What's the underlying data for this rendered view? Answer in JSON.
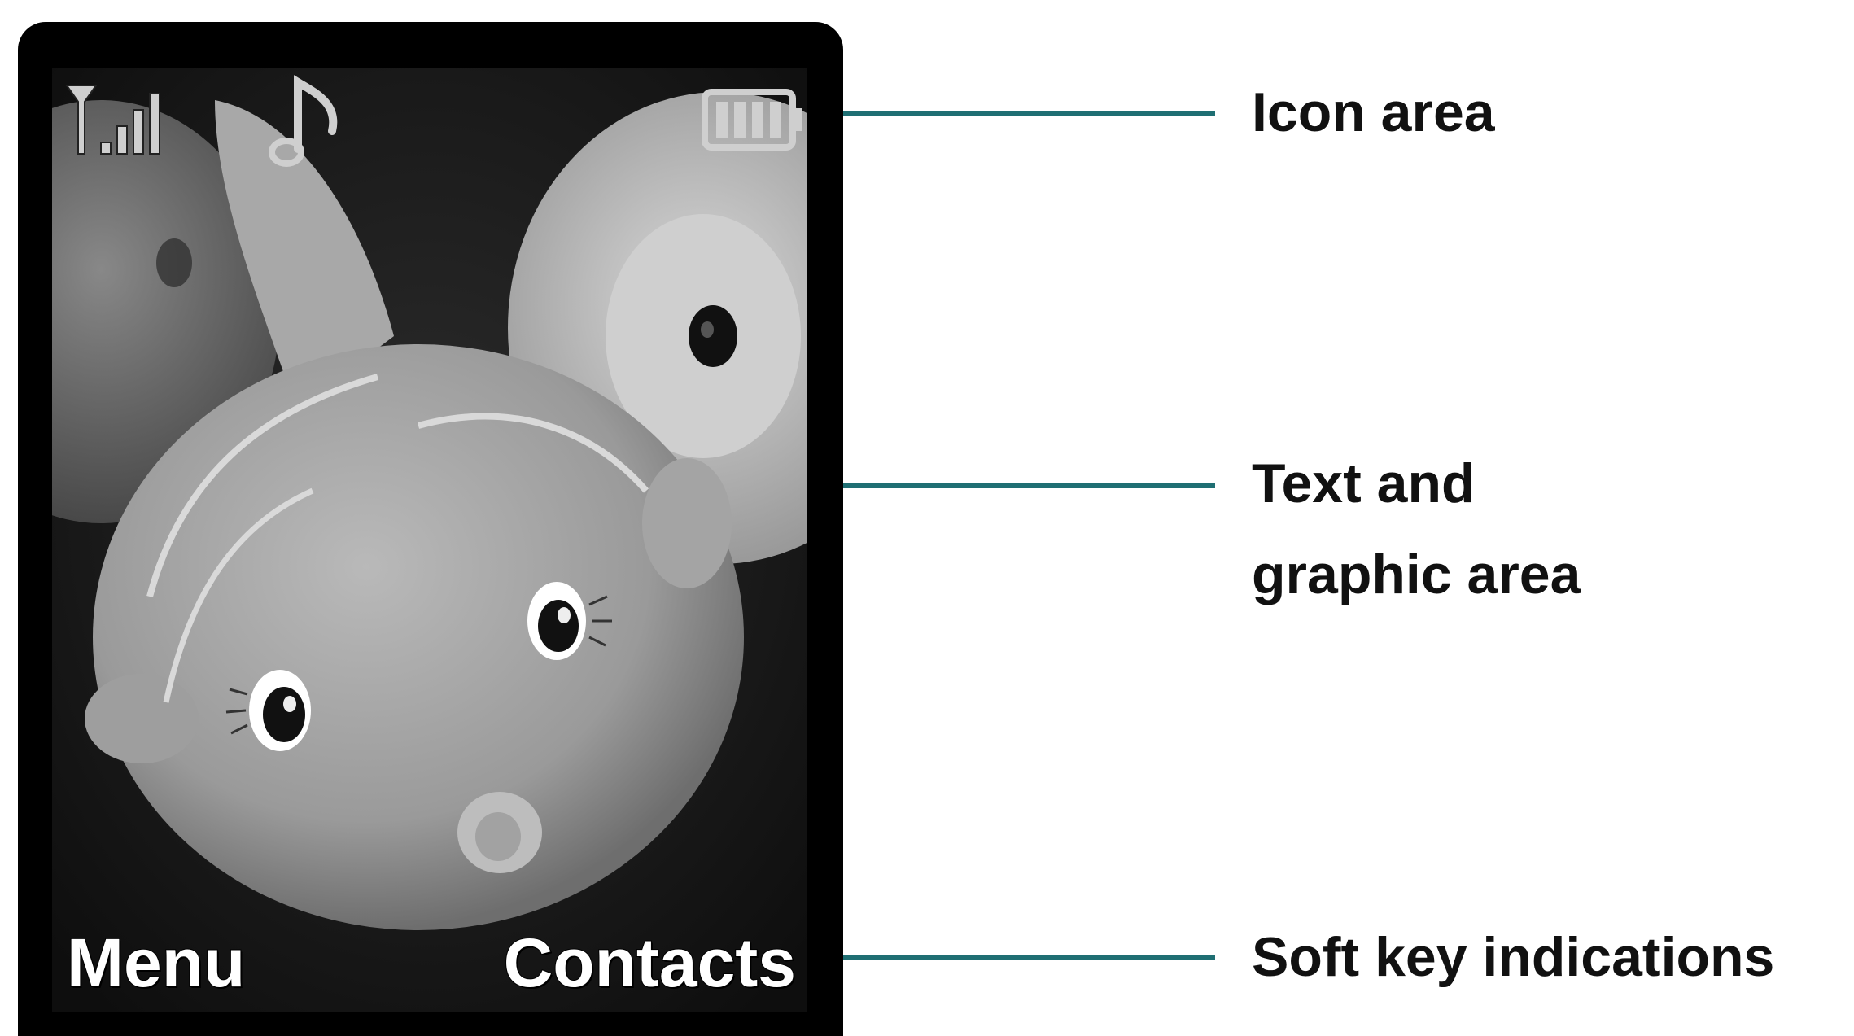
{
  "phone": {
    "soft_keys": {
      "left": "Menu",
      "right": "Contacts"
    },
    "status_icons": [
      "signal-strength-icon",
      "music-note-icon",
      "battery-icon"
    ],
    "wallpaper": "grayscale plush fish toys"
  },
  "callouts": {
    "icon_area": "Icon area",
    "text_graphic_line1": "Text and",
    "text_graphic_line2": "graphic area",
    "soft_key": "Soft key indications"
  },
  "colors": {
    "frame": "#000000",
    "leader_line": "#1f6f73",
    "label_text": "#111111",
    "soft_key_text": "#ffffff"
  }
}
